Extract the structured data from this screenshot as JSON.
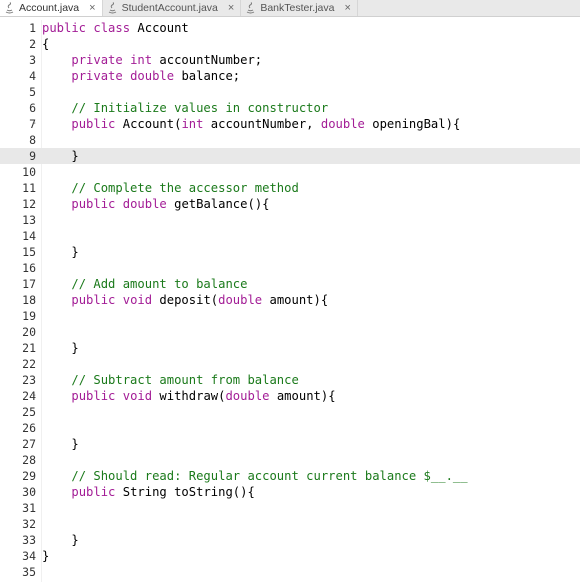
{
  "tabs": [
    {
      "label": "Account.java",
      "active": true
    },
    {
      "label": "StudentAccount.java",
      "active": false
    },
    {
      "label": "BankTester.java",
      "active": false
    }
  ],
  "close_glyph": "×",
  "lines": [
    {
      "n": "1",
      "fold": "",
      "tokens": [
        [
          "kw",
          "public "
        ],
        [
          "kw",
          "class "
        ],
        [
          "",
          "Account"
        ]
      ]
    },
    {
      "n": "2",
      "fold": "-",
      "tokens": [
        [
          "",
          "{"
        ]
      ]
    },
    {
      "n": "3",
      "fold": "",
      "tokens": [
        [
          "",
          "    "
        ],
        [
          "kw",
          "private "
        ],
        [
          "kw",
          "int "
        ],
        [
          "",
          "accountNumber;"
        ]
      ]
    },
    {
      "n": "4",
      "fold": "",
      "tokens": [
        [
          "",
          "    "
        ],
        [
          "kw",
          "private "
        ],
        [
          "kw",
          "double "
        ],
        [
          "",
          "balance;"
        ]
      ]
    },
    {
      "n": "5",
      "fold": "",
      "tokens": []
    },
    {
      "n": "6",
      "fold": "",
      "tokens": [
        [
          "",
          "    "
        ],
        [
          "cm",
          "// Initialize values in constructor"
        ]
      ]
    },
    {
      "n": "7",
      "fold": "-",
      "tokens": [
        [
          "",
          "    "
        ],
        [
          "kw",
          "public "
        ],
        [
          "",
          "Account("
        ],
        [
          "kw",
          "int "
        ],
        [
          "",
          "accountNumber, "
        ],
        [
          "kw",
          "double "
        ],
        [
          "",
          "openingBal){"
        ]
      ]
    },
    {
      "n": "8",
      "fold": "",
      "tokens": []
    },
    {
      "n": "9",
      "fold": "",
      "tokens": [
        [
          "",
          "    }"
        ]
      ],
      "current": true
    },
    {
      "n": "10",
      "fold": "",
      "tokens": []
    },
    {
      "n": "11",
      "fold": "",
      "tokens": [
        [
          "",
          "    "
        ],
        [
          "cm",
          "// Complete the accessor method"
        ]
      ]
    },
    {
      "n": "12",
      "fold": "-",
      "tokens": [
        [
          "",
          "    "
        ],
        [
          "kw",
          "public "
        ],
        [
          "kw",
          "double "
        ],
        [
          "",
          "getBalance(){"
        ]
      ]
    },
    {
      "n": "13",
      "fold": "",
      "tokens": []
    },
    {
      "n": "14",
      "fold": "",
      "tokens": []
    },
    {
      "n": "15",
      "fold": "",
      "tokens": [
        [
          "",
          "    }"
        ]
      ]
    },
    {
      "n": "16",
      "fold": "",
      "tokens": []
    },
    {
      "n": "17",
      "fold": "",
      "tokens": [
        [
          "",
          "    "
        ],
        [
          "cm",
          "// Add amount to balance"
        ]
      ]
    },
    {
      "n": "18",
      "fold": "-",
      "tokens": [
        [
          "",
          "    "
        ],
        [
          "kw",
          "public "
        ],
        [
          "kw",
          "void "
        ],
        [
          "",
          "deposit("
        ],
        [
          "kw",
          "double "
        ],
        [
          "",
          "amount){"
        ]
      ]
    },
    {
      "n": "19",
      "fold": "",
      "tokens": []
    },
    {
      "n": "20",
      "fold": "",
      "tokens": []
    },
    {
      "n": "21",
      "fold": "",
      "tokens": [
        [
          "",
          "    }"
        ]
      ]
    },
    {
      "n": "22",
      "fold": "",
      "tokens": []
    },
    {
      "n": "23",
      "fold": "",
      "tokens": [
        [
          "",
          "    "
        ],
        [
          "cm",
          "// Subtract amount from balance"
        ]
      ]
    },
    {
      "n": "24",
      "fold": "-",
      "tokens": [
        [
          "",
          "    "
        ],
        [
          "kw",
          "public "
        ],
        [
          "kw",
          "void "
        ],
        [
          "",
          "withdraw("
        ],
        [
          "kw",
          "double "
        ],
        [
          "",
          "amount){"
        ]
      ]
    },
    {
      "n": "25",
      "fold": "",
      "tokens": []
    },
    {
      "n": "26",
      "fold": "",
      "tokens": []
    },
    {
      "n": "27",
      "fold": "",
      "tokens": [
        [
          "",
          "    }"
        ]
      ]
    },
    {
      "n": "28",
      "fold": "",
      "tokens": []
    },
    {
      "n": "29",
      "fold": "",
      "tokens": [
        [
          "",
          "    "
        ],
        [
          "cm",
          "// Should read: Regular account current balance $__.__"
        ]
      ]
    },
    {
      "n": "30",
      "fold": "-",
      "tokens": [
        [
          "",
          "    "
        ],
        [
          "kw",
          "public "
        ],
        [
          "",
          "String toString(){"
        ]
      ]
    },
    {
      "n": "31",
      "fold": "",
      "tokens": []
    },
    {
      "n": "32",
      "fold": "",
      "tokens": []
    },
    {
      "n": "33",
      "fold": "",
      "tokens": [
        [
          "",
          "    }"
        ]
      ]
    },
    {
      "n": "34",
      "fold": "",
      "tokens": [
        [
          "",
          "}"
        ]
      ]
    },
    {
      "n": "35",
      "fold": "",
      "tokens": []
    }
  ],
  "colors": {
    "keyword": "#a31d96",
    "comment": "#1b7a1b",
    "current_line": "#e8e8e8"
  },
  "icons": {
    "tab": "java-file-icon",
    "close": "close-icon",
    "fold": "fold-toggle-icon"
  }
}
